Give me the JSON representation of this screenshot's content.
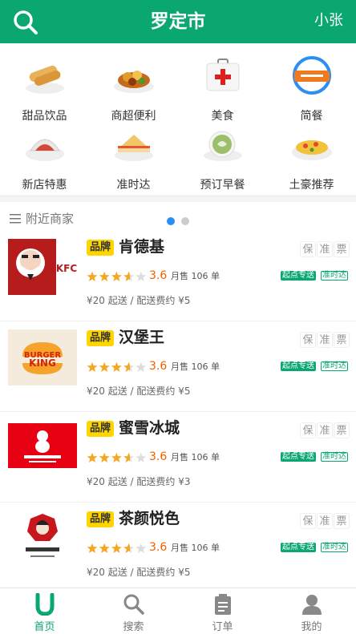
{
  "header": {
    "city": "罗定市",
    "user": "小张",
    "search_icon": "search-icon"
  },
  "categories": [
    {
      "label": "甜品饮品",
      "icon": "spring-roll-icon"
    },
    {
      "label": "商超便利",
      "icon": "food-bowl-icon"
    },
    {
      "label": "美食",
      "icon": "first-aid-kit-icon"
    },
    {
      "label": "简餐",
      "icon": "supermarket-express-icon"
    },
    {
      "label": "新店特惠",
      "icon": "seafood-plate-icon"
    },
    {
      "label": "准时达",
      "icon": "sandwich-icon"
    },
    {
      "label": "预订早餐",
      "icon": "latte-icon"
    },
    {
      "label": "土豪推荐",
      "icon": "pasta-icon"
    }
  ],
  "carousel": {
    "pages": 2,
    "active": 0
  },
  "nearby": {
    "title": "附近商家"
  },
  "merchants": [
    {
      "brand": "品牌",
      "name": "肯德基",
      "tags": [
        "保",
        "准",
        "票"
      ],
      "rating": 3.6,
      "rating_text": "3.6",
      "sales": "月售 106 单",
      "badge_a": "起点专送",
      "badge_b": "准时达",
      "delivery": "¥20 起送 / 配送费约 ¥5",
      "logo": "kfc-logo"
    },
    {
      "brand": "品牌",
      "name": "汉堡王",
      "tags": [
        "保",
        "准",
        "票"
      ],
      "rating": 3.6,
      "rating_text": "3.6",
      "sales": "月售 106 单",
      "badge_a": "起点专送",
      "badge_b": "准时达",
      "delivery": "¥20 起送 / 配送费约 ¥5",
      "logo": "burger-king-logo",
      "logo_text": [
        "BURGER",
        "KING"
      ]
    },
    {
      "brand": "品牌",
      "name": "蜜雪冰城",
      "tags": [
        "保",
        "准",
        "票"
      ],
      "rating": 3.6,
      "rating_text": "3.6",
      "sales": "月售 106 单",
      "badge_a": "起点专送",
      "badge_b": "准时达",
      "delivery": "¥20 起送 / 配送费约 ¥3",
      "logo": "mixue-logo"
    },
    {
      "brand": "品牌",
      "name": "茶颜悦色",
      "tags": [
        "保",
        "准",
        "票"
      ],
      "rating": 3.6,
      "rating_text": "3.6",
      "sales": "月售 106 单",
      "badge_a": "起点专送",
      "badge_b": "准时达",
      "delivery": "¥20 起送 / 配送费约 ¥5",
      "logo": "chayan-logo"
    }
  ],
  "tabbar": [
    {
      "label": "首页",
      "icon": "home-u-icon",
      "active": true
    },
    {
      "label": "搜索",
      "icon": "search-icon",
      "active": false
    },
    {
      "label": "订单",
      "icon": "clipboard-icon",
      "active": false
    },
    {
      "label": "我的",
      "icon": "user-icon",
      "active": false
    }
  ],
  "colors": {
    "brand_green": "#0aa770",
    "star": "#f5a623",
    "score": "#f06000",
    "brand_tag": "#ffd500",
    "dot_active": "#2b8ef2"
  }
}
